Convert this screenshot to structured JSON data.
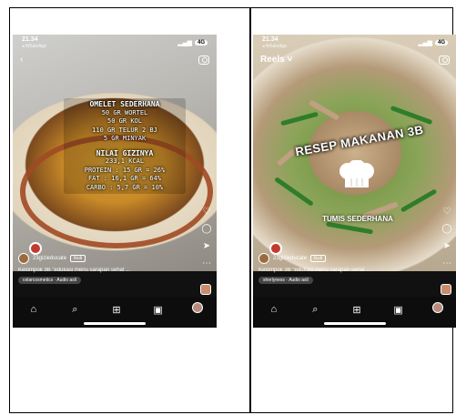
{
  "status": {
    "time": "21.34",
    "back_label": "◂ WhatsApp",
    "battery": "4G"
  },
  "left": {
    "recipe": {
      "title": "OMELET SEDERHANA",
      "lines": [
        "50 GR WORTEL",
        "50 GR KOL",
        "110 GR TELUR 2 BJ",
        "5 GR MINYAK"
      ],
      "nutrition_title": "NILAI GIZINYA",
      "nutrition_lines": [
        "233,1 KCAL",
        "PROTEIN : 15 GR = 26%",
        "FAT : 16,1 GR = 64%",
        "CARBO : 5,7 GR = 10%"
      ]
    },
    "username": "23gizieducate",
    "follow_label": "Ikuti",
    "caption": "Kelompok 3B \"edukasi menu sarapan sehat ...",
    "audio": "celarcosmetics · Audio asli"
  },
  "right": {
    "reels_label": "Reels",
    "title": "RESEP MAKANAN 3B",
    "subtitle": "TUMIS SEDERHANA",
    "username": "23gizieducate",
    "follow_label": "Ikuti",
    "caption": "Kelompok 3B \"edukasi menu sarapan sehat ...",
    "audio": "sherlyness · Audio asli"
  },
  "icons": {
    "like": "heart-icon",
    "comment": "comment-icon",
    "share": "send-icon",
    "more": "more-icon",
    "home": "home-icon",
    "search": "search-icon",
    "create": "add-icon",
    "reels": "reels-icon"
  }
}
